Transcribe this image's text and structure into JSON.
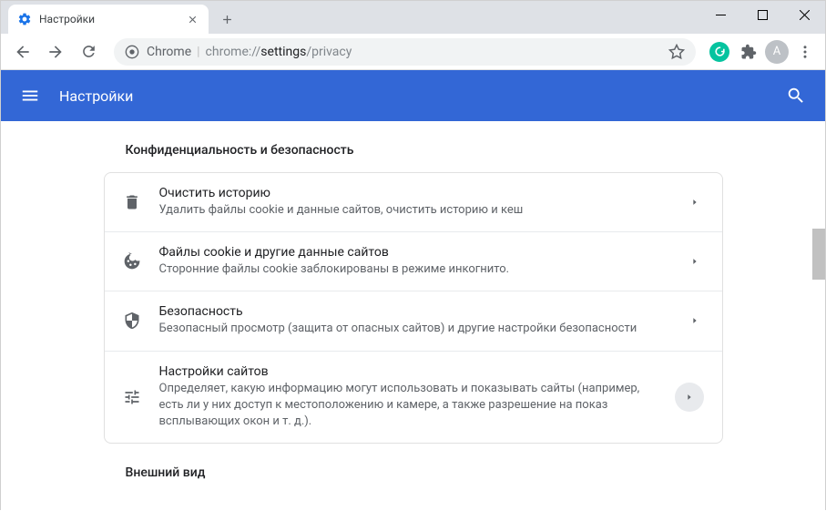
{
  "tab": {
    "title": "Настройки"
  },
  "omnibox": {
    "chrome_label": "Chrome",
    "url_prefix": "chrome://",
    "url_path": "settings",
    "url_suffix": "/privacy"
  },
  "avatar_letter": "A",
  "header": {
    "title": "Настройки"
  },
  "section1": {
    "title": "Конфиденциальность и безопасность",
    "rows": [
      {
        "title": "Очистить историю",
        "sub": "Удалить файлы cookie и данные сайтов, очистить историю и кеш"
      },
      {
        "title": "Файлы cookie и другие данные сайтов",
        "sub": "Сторонние файлы cookie заблокированы в режиме инкогнито."
      },
      {
        "title": "Безопасность",
        "sub": "Безопасный просмотр (защита от опасных сайтов) и другие настройки безопасности"
      },
      {
        "title": "Настройки сайтов",
        "sub": "Определяет, какую информацию могут использовать и показывать сайты (например, есть ли у них доступ к местоположению и камере, а также разрешение на показ всплывающих окон и т. д.)."
      }
    ]
  },
  "section2": {
    "title": "Внешний вид"
  }
}
